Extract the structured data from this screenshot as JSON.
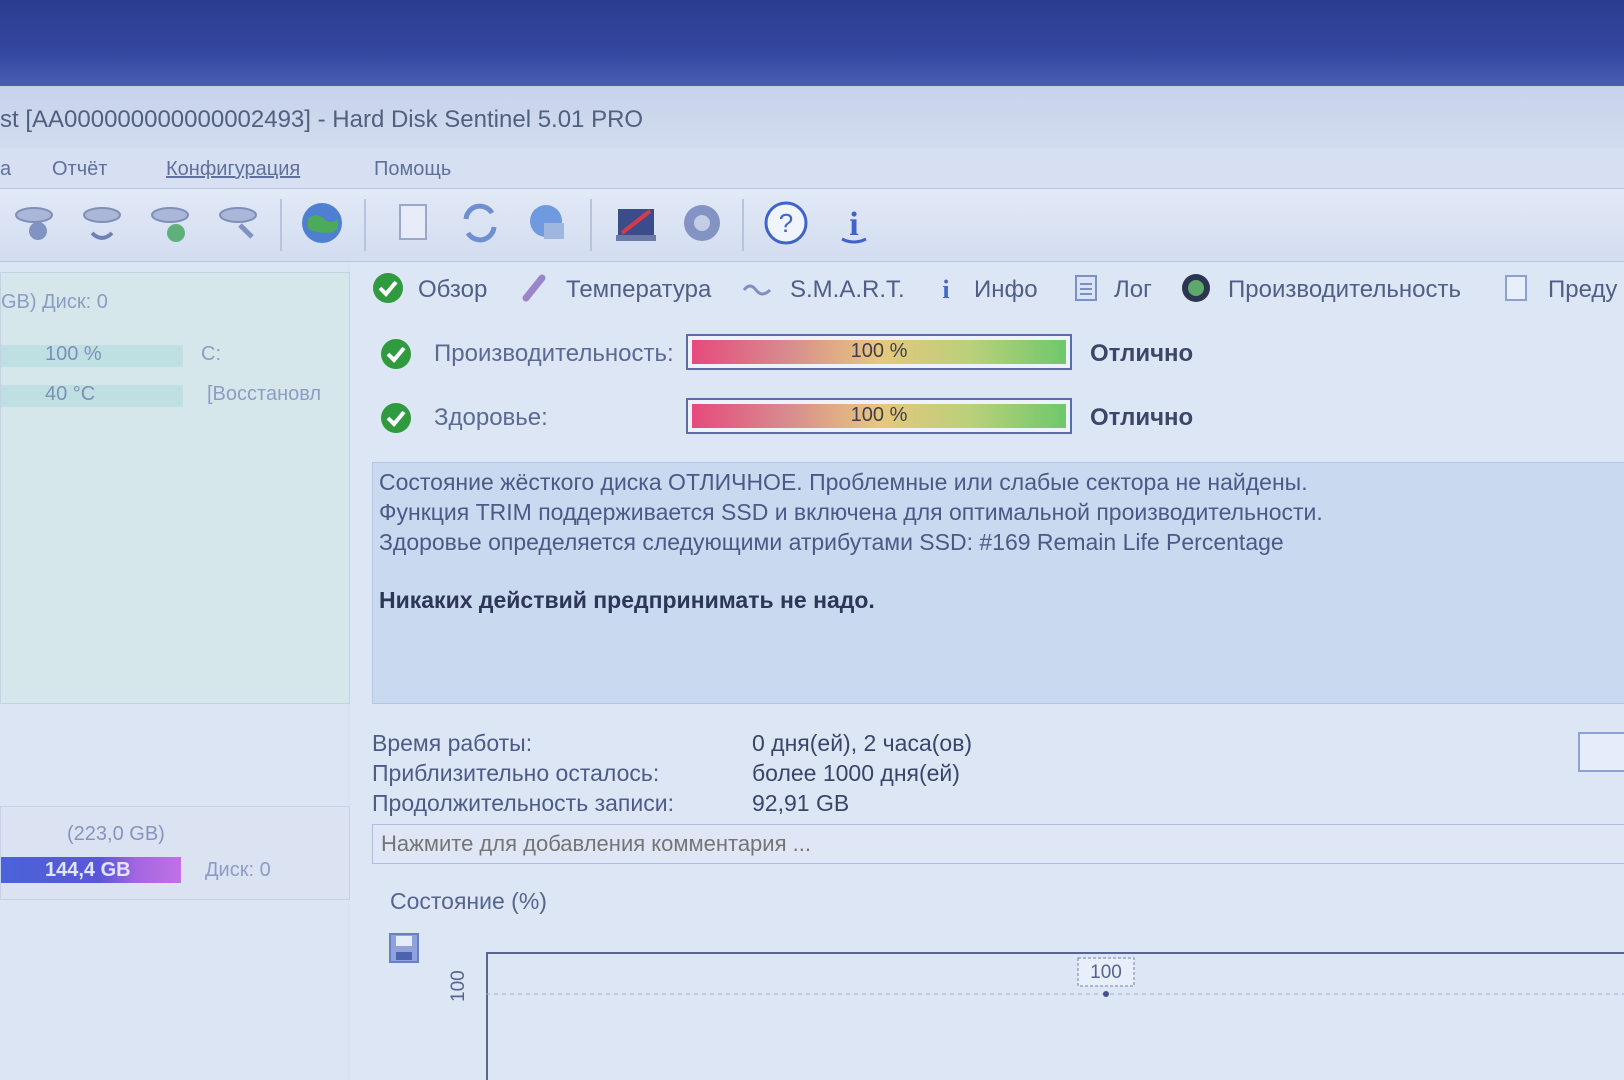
{
  "window": {
    "title": "st [AA000000000000002493]  -  Hard Disk Sentinel 5.01 PRO"
  },
  "menu": {
    "items": [
      "a",
      "Отчёт",
      "Конфигурация",
      "Помощь"
    ]
  },
  "left_panel": {
    "disk_header": "GB) Диск: 0",
    "health_value": "100 %",
    "drive_letter": "C:",
    "temp_value": "40 °C",
    "status_text": "[Восстановл",
    "volume_size": "(223,0 GB)",
    "volume_used": "144,4 GB",
    "volume_disk": "Диск: 0"
  },
  "tabs": [
    {
      "label": "Обзор",
      "icon": "check-icon"
    },
    {
      "label": "Температура",
      "icon": "thermometer-icon"
    },
    {
      "label": "S.M.A.R.T.",
      "icon": "smart-icon"
    },
    {
      "label": "Инфо",
      "icon": "info-icon"
    },
    {
      "label": "Лог",
      "icon": "log-icon"
    },
    {
      "label": "Производительность",
      "icon": "performance-icon"
    },
    {
      "label": "Преду",
      "icon": "alerts-icon"
    }
  ],
  "status": {
    "performance": {
      "label": "Производительность:",
      "value_text": "100 %",
      "value": 100,
      "rating": "Отлично"
    },
    "health": {
      "label": "Здоровье:",
      "value_text": "100 %",
      "value": 100,
      "rating": "Отлично"
    }
  },
  "message": {
    "line1": "Состояние жёсткого диска ОТЛИЧНОЕ. Проблемные или слабые сектора не найдены.",
    "line2": "Функция TRIM поддерживается SSD и включена для оптимальной производительности.",
    "line3": "Здоровье определяется следующими атрибутами SSD: #169 Remain Life Percentage",
    "action": "Никаких действий предпринимать не надо."
  },
  "info": {
    "uptime_label": "Время работы:",
    "uptime_value": "0 дня(ей), 2 часа(ов)",
    "remaining_label": "Приблизительно осталось:",
    "remaining_value": "более 1000 дня(ей)",
    "written_label": "Продолжительность записи:",
    "written_value": "92,91 GB"
  },
  "comment": {
    "placeholder": "Нажмите для добавления комментария ..."
  },
  "chart_data": {
    "type": "line",
    "title": "Состояние (%)",
    "y_tick": "100",
    "points": [
      {
        "label": "100",
        "value": 100
      }
    ]
  },
  "colors": {
    "accent": "#5b6ca9",
    "ok_green": "#2f9a3e"
  }
}
